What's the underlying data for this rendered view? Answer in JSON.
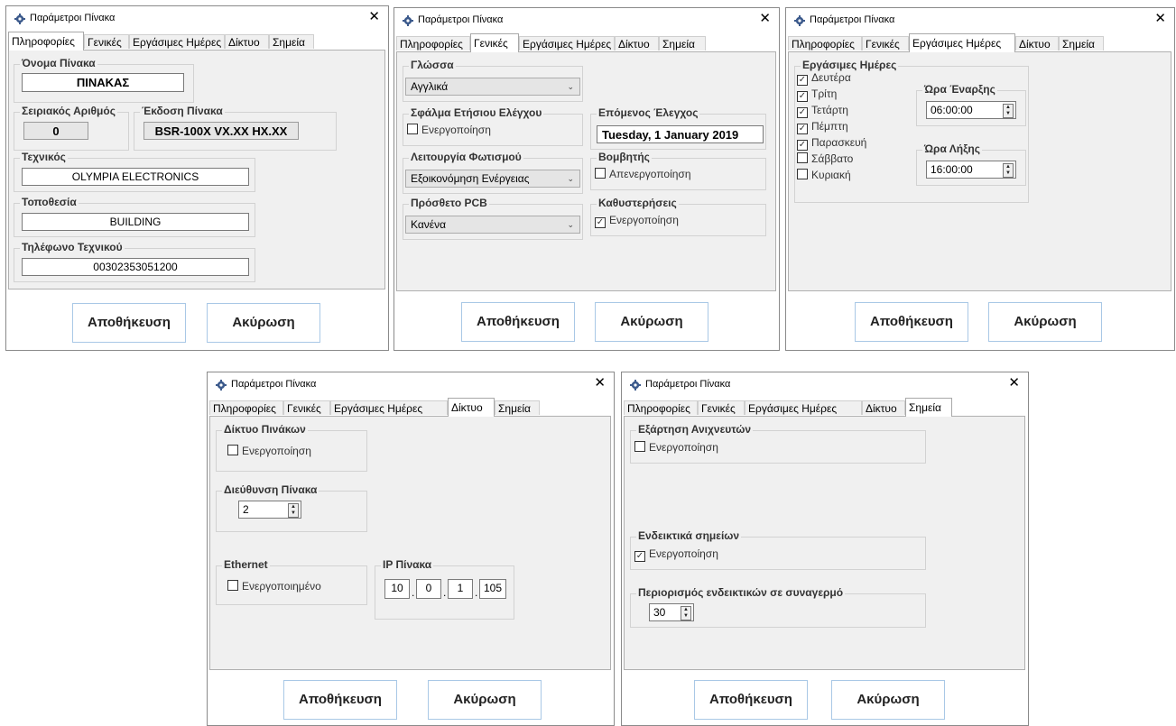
{
  "window_title": "Παράμετροι Πίνακα",
  "close_glyph": "✕",
  "tabs": [
    "Πληροφορίες",
    "Γενικές",
    "Εργάσιμες Ημέρες",
    "Δίκτυο",
    "Σημεία"
  ],
  "buttons": {
    "save": "Αποθήκευση",
    "cancel": "Ακύρωση"
  },
  "info": {
    "panel_name_label": "Όνομα Πίνακα",
    "panel_name_value": "ΠΙΝΑΚΑΣ",
    "serial_label": "Σειριακός Αριθμός",
    "serial_value": "0",
    "version_label": "Έκδοση Πίνακα",
    "version_value": "BSR-100X VX.XX HX.XX",
    "technician_label": "Τεχνικός",
    "technician_value": "OLYMPIA ELECTRONICS",
    "location_label": "Τοποθεσία",
    "location_value": "BUILDING",
    "phone_label": "Τηλέφωνο Τεχνικού",
    "phone_value": "00302353051200"
  },
  "general": {
    "language_label": "Γλώσσα",
    "language_value": "Αγγλικά",
    "annual_error_label": "Σφάλμα Ετήσιου Ελέγχου",
    "annual_error_check": "Ενεργοποίηση",
    "next_check_label": "Επόμενος Έλεγχος",
    "next_check_value": "Tuesday, 1 January 2019",
    "lighting_label": "Λειτουργία Φωτισμού",
    "lighting_value": "Εξοικονόμηση Ενέργειας",
    "buzzer_label": "Βομβητής",
    "buzzer_check": "Απενεργοποίηση",
    "pcb_label": "Πρόσθετο PCB",
    "pcb_value": "Κανένα",
    "delays_label": "Καθυστερήσεις",
    "delays_check": "Ενεργοποίηση"
  },
  "workdays": {
    "group_label": "Εργάσιμες Ημέρες",
    "days": [
      {
        "name": "Δευτέρα",
        "checked": true
      },
      {
        "name": "Τρίτη",
        "checked": true
      },
      {
        "name": "Τετάρτη",
        "checked": true
      },
      {
        "name": "Πέμπτη",
        "checked": true
      },
      {
        "name": "Παρασκευή",
        "checked": true
      },
      {
        "name": "Σάββατο",
        "checked": false
      },
      {
        "name": "Κυριακή",
        "checked": false
      }
    ],
    "start_label": "Ώρα Έναρξης",
    "start_value": "06:00:00",
    "end_label": "Ώρα Λήξης",
    "end_value": "16:00:00"
  },
  "network": {
    "panel_network_label": "Δίκτυο Πινάκων",
    "panel_network_check": "Ενεργοποίηση",
    "address_label": "Διεύθυνση Πίνακα",
    "address_value": "2",
    "ethernet_label": "Ethernet",
    "ethernet_check": "Ενεργοποιημένο",
    "ip_label": "IP Πίνακα",
    "ip": [
      "10",
      "0",
      "1",
      "105"
    ]
  },
  "points": {
    "detector_label": "Εξάρτηση Ανιχνευτών",
    "detector_check": "Ενεργοποίηση",
    "indicators_label": "Ενδεικτικά σημείων",
    "indicators_check": "Ενεργοποίηση",
    "limit_label": "Περιορισμός ενδεικτικών σε συναγερμό",
    "limit_value": "30"
  }
}
